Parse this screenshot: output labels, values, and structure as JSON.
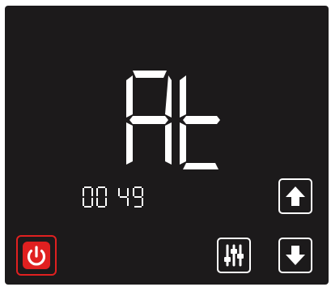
{
  "display": {
    "main_text": "At",
    "sub_text": "00 49"
  },
  "controls": {
    "up_icon": "arrow-up-icon",
    "down_icon": "arrow-down-icon",
    "settings_icon": "sliders-icon",
    "power_icon": "power-icon"
  },
  "colors": {
    "panel_background": "#1c1a1b",
    "segment_color": "#ffffff",
    "power_accent": "#e02020"
  }
}
